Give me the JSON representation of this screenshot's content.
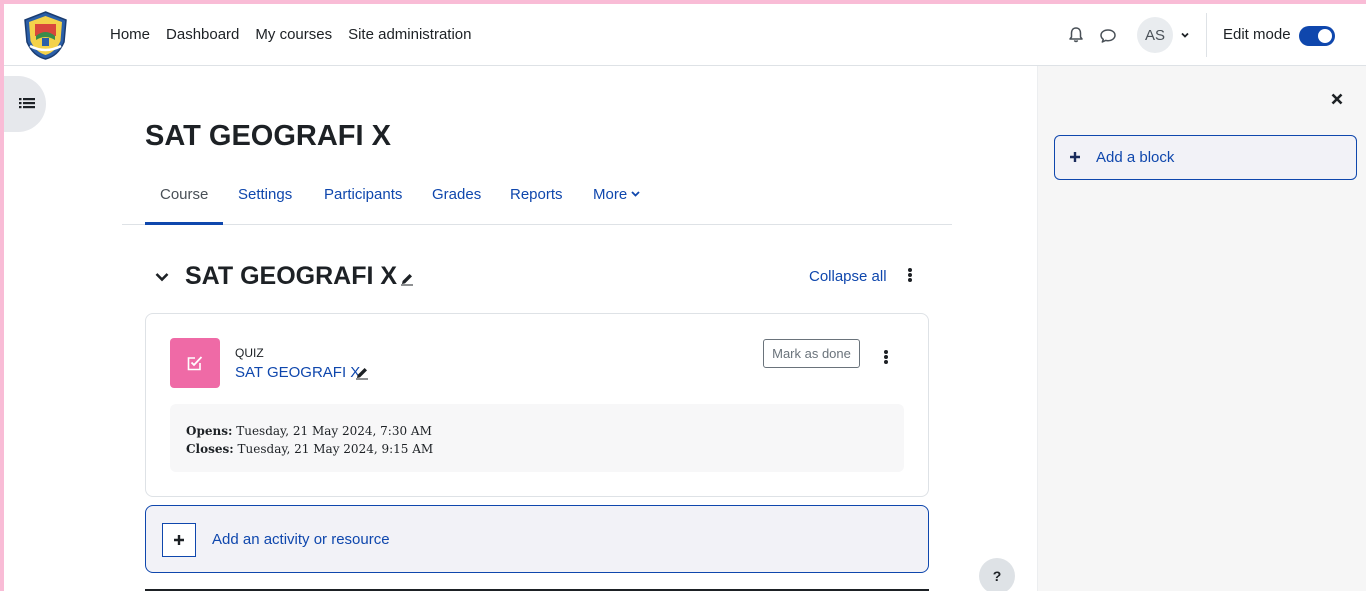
{
  "navbar": {
    "links": [
      "Home",
      "Dashboard",
      "My courses",
      "Site administration"
    ],
    "avatar_initials": "AS",
    "edit_mode_label": "Edit mode",
    "edit_mode_on": true
  },
  "course": {
    "title": "SAT GEOGRAFI X",
    "tabs": [
      "Course",
      "Settings",
      "Participants",
      "Grades",
      "Reports",
      "More"
    ],
    "active_tab": "Course"
  },
  "section": {
    "title": "SAT GEOGRAFI X",
    "collapse_all_label": "Collapse all"
  },
  "activity": {
    "type_label": "QUIZ",
    "name": "SAT GEOGRAFI X",
    "mark_done_label": "Mark as done",
    "opens_label": "Opens:",
    "opens_value": "Tuesday, 21 May 2024, 7:30 AM",
    "closes_label": "Closes:",
    "closes_value": "Tuesday, 21 May 2024, 9:15 AM",
    "icon_color": "#ef6aa6"
  },
  "add_activity_label": "Add an activity or resource",
  "help_label": "?",
  "block_drawer": {
    "add_block_label": "Add a block"
  },
  "colors": {
    "primary": "#0f47ad",
    "frame": "#f9bcd6"
  }
}
